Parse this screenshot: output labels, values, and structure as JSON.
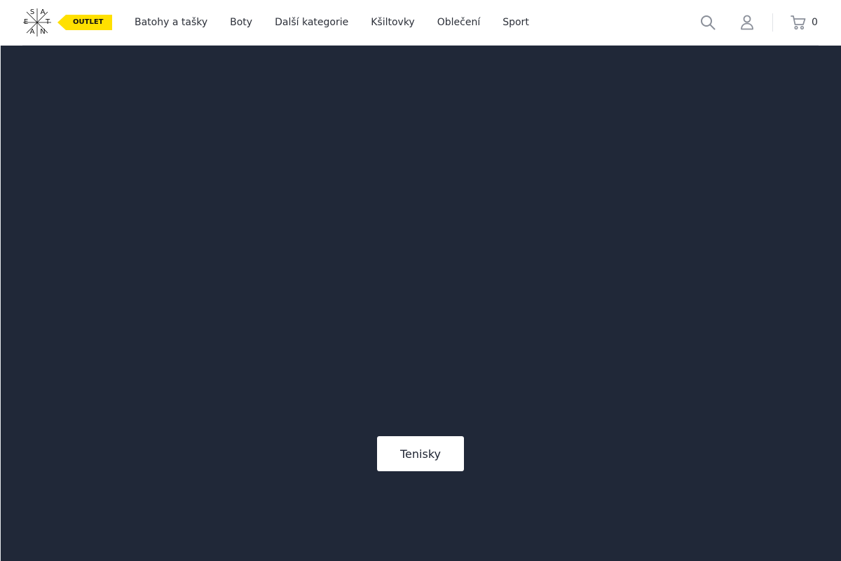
{
  "header": {
    "logo": {
      "letters": [
        "S",
        "A",
        "E",
        "T",
        "A",
        "N"
      ],
      "badge_text": "OUTLET",
      "badge_color": "#ffe000"
    },
    "nav": [
      {
        "label": "Batohy a tašky"
      },
      {
        "label": "Boty"
      },
      {
        "label": "Další kategorie"
      },
      {
        "label": "Kšiltovky"
      },
      {
        "label": "Oblečení"
      },
      {
        "label": "Sport"
      }
    ],
    "icons": {
      "search": "search-icon",
      "account": "user-icon",
      "cart": "cart-icon"
    },
    "cart_count": "0"
  },
  "hero": {
    "background_color": "#202838",
    "button_label": "Tenisky"
  }
}
